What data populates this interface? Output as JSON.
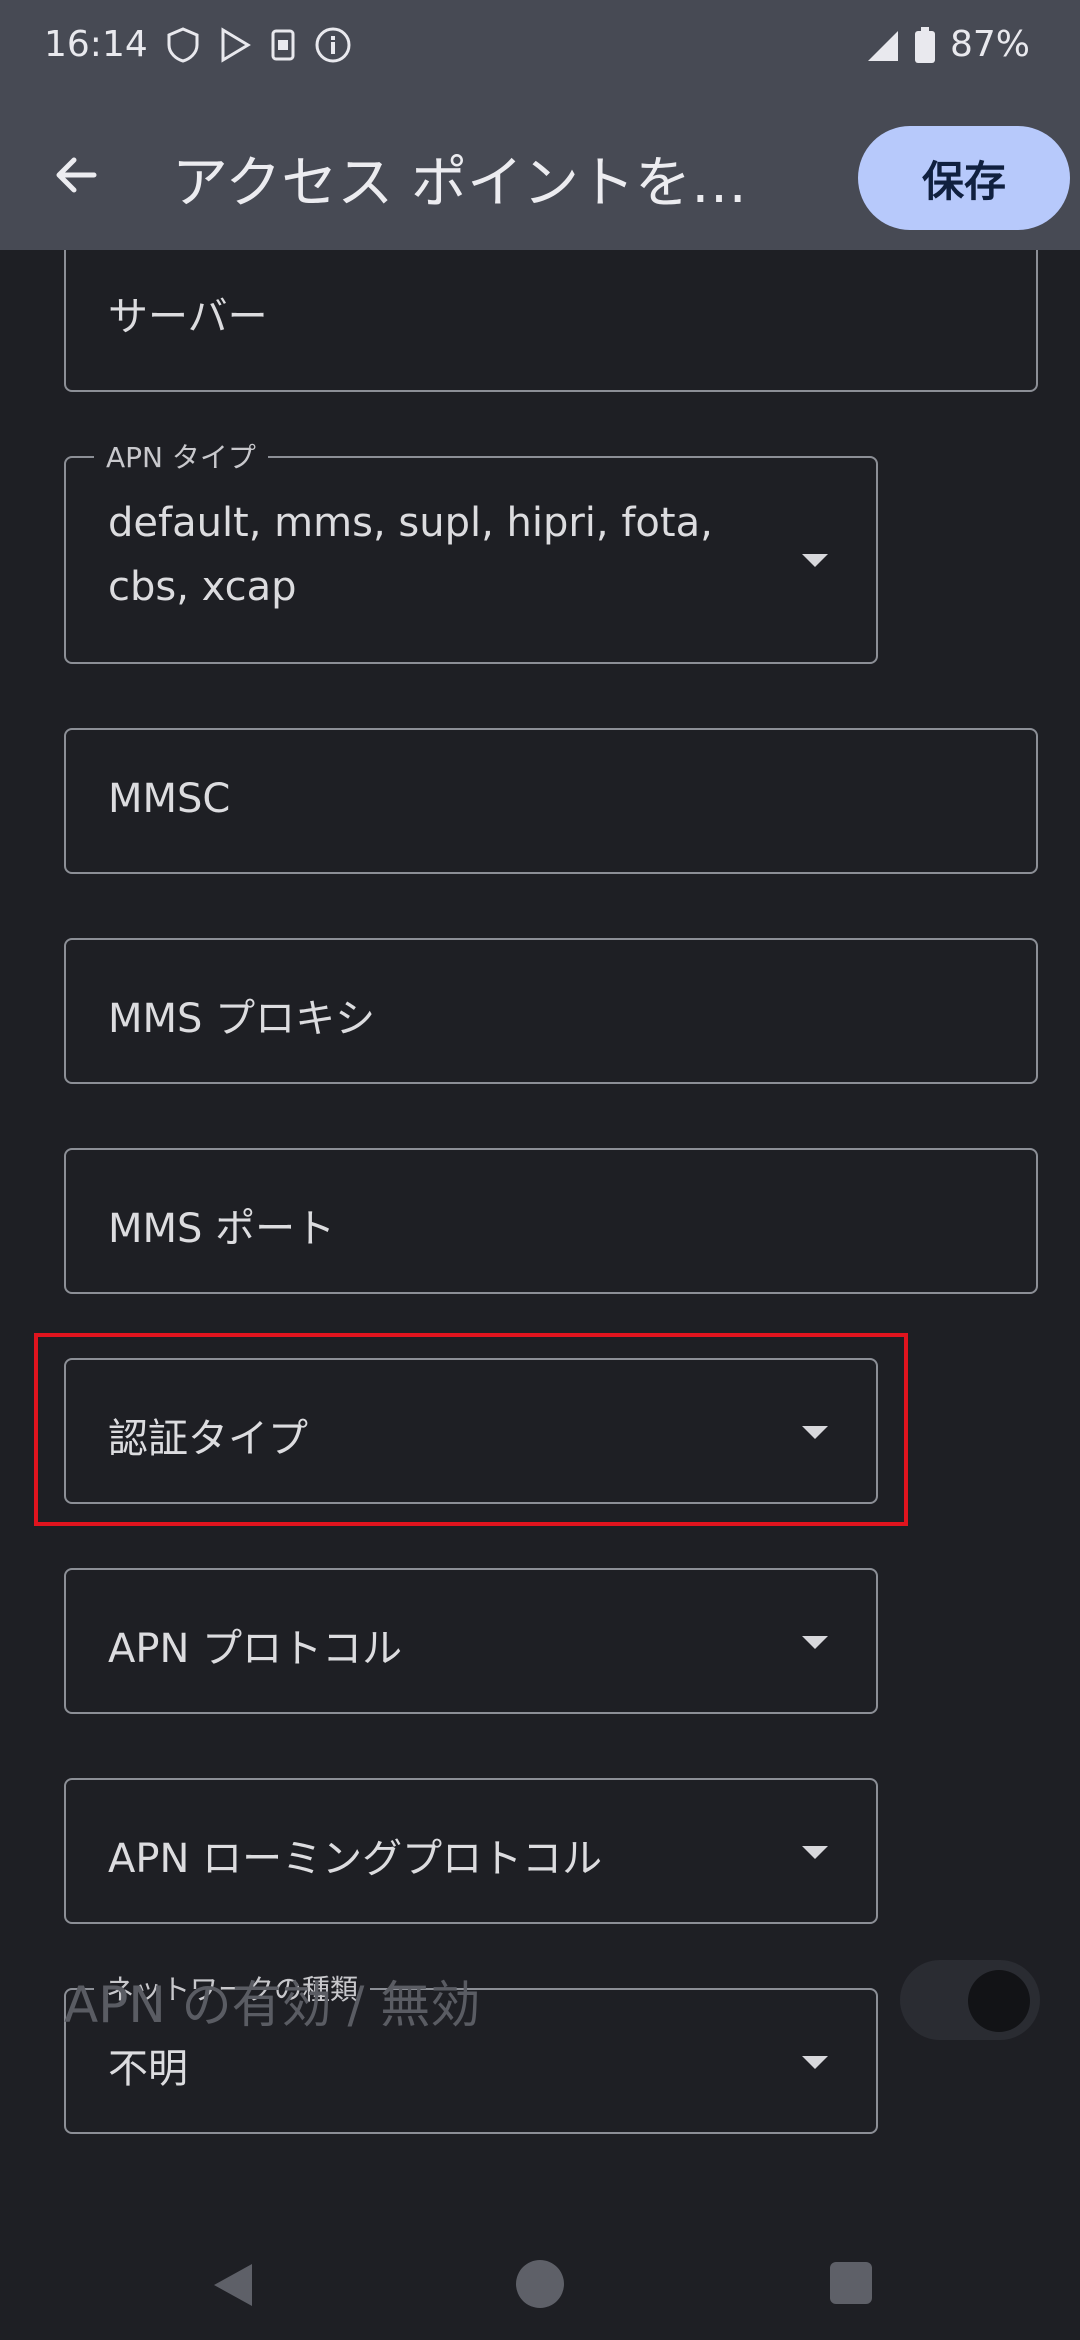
{
  "status_bar": {
    "time": "16:14",
    "battery": "87%"
  },
  "app_bar": {
    "title": "アクセス ポイントを…",
    "save_label": "保存"
  },
  "fields": [
    {
      "name": "server",
      "value": "サーバー"
    },
    {
      "name": "apn-type",
      "legend": "APN タイプ",
      "value_line1": "default, mms, supl, hipri, fota,",
      "value_line2": "cbs, xcap"
    },
    {
      "name": "mmsc",
      "value": "MMSC"
    },
    {
      "name": "mms-proxy",
      "value": "MMS プロキシ"
    },
    {
      "name": "mms-port",
      "value": "MMS ポート"
    },
    {
      "name": "auth-type",
      "value": "認証タイプ"
    },
    {
      "name": "apn-protocol",
      "value": "APN プロトコル"
    },
    {
      "name": "apn-roaming-protocol",
      "value": "APN ローミングプロトコル"
    },
    {
      "name": "network-type",
      "legend": "ネットワークの種類",
      "value": "不明"
    }
  ],
  "apn_toggle_label": "APN の有効 / 無効",
  "icons": [
    "shield-icon",
    "play-store-icon",
    "sim-icon",
    "info-icon",
    "signal-icon",
    "battery-icon",
    "back-arrow-icon",
    "dropdown-caret-icon",
    "nav-back-icon",
    "nav-home-icon",
    "nav-recents-icon"
  ],
  "colors": {
    "highlight": "#e0141e",
    "save_button": "#b7c9fb",
    "app_bar": "#474a54",
    "background": "#1e1f24"
  }
}
